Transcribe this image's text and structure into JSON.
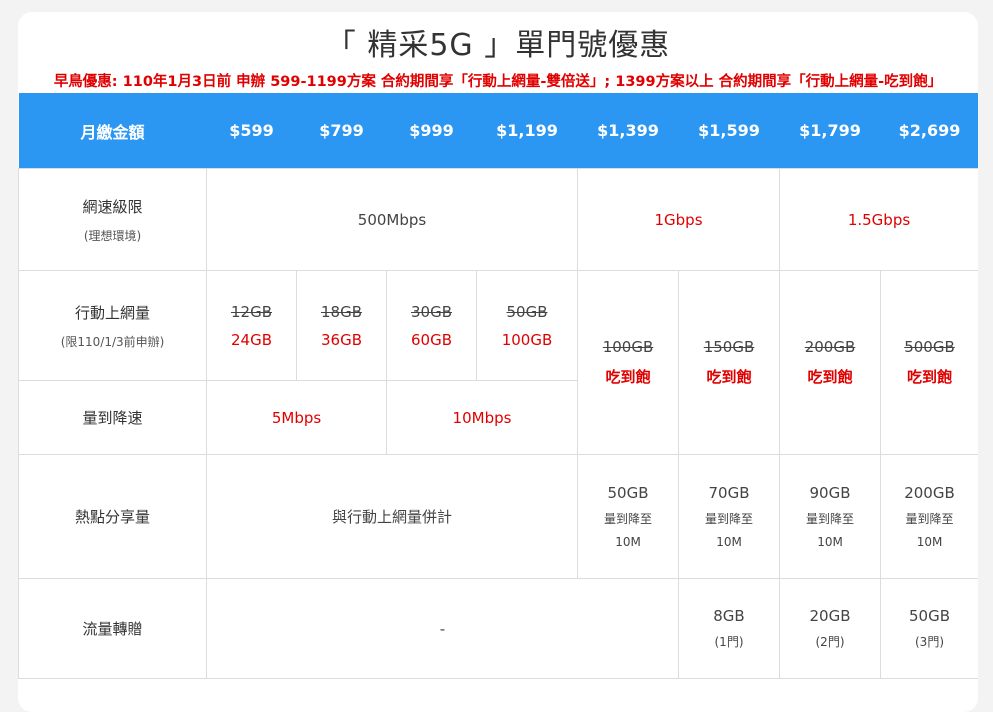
{
  "title": "「 精采5G 」單門號優惠",
  "promo": "早鳥優惠: 110年1月3日前 申辦 599-1199方案 合約期間享「行動上網量-雙倍送」; 1399方案以上 合約期間享「行動上網量-吃到飽」",
  "header": {
    "label": "月繳金額",
    "prices": [
      "$599",
      "$799",
      "$999",
      "$1,199",
      "$1,399",
      "$1,599",
      "$1,799",
      "$2,699"
    ]
  },
  "speed": {
    "label": "網速級限",
    "sub": "(理想環境)",
    "v1": "500Mbps",
    "v2": "1Gbps",
    "v3": "1.5Gbps"
  },
  "data": {
    "label": "行動上網量",
    "sub": "(限110/1/3前申辦)",
    "old": [
      "12GB",
      "18GB",
      "30GB",
      "50GB",
      "100GB",
      "150GB",
      "200GB",
      "500GB"
    ],
    "new": [
      "24GB",
      "36GB",
      "60GB",
      "100GB"
    ],
    "unlimited": "吃到飽"
  },
  "throttle": {
    "label": "量到降速",
    "v1": "5Mbps",
    "v2": "10Mbps"
  },
  "hotspot": {
    "label": "熱點分享量",
    "shared": "與行動上網量併計",
    "amounts": [
      "50GB",
      "70GB",
      "90GB",
      "200GB"
    ],
    "line2": "量到降至",
    "line3": "10M"
  },
  "gift": {
    "label": "流量轉贈",
    "none": "-",
    "amounts": [
      "8GB",
      "20GB",
      "50GB"
    ],
    "lines": [
      "(1門)",
      "(2門)",
      "(3門)"
    ]
  },
  "colors": {
    "accent": "#2c97f3",
    "highlight": "#e00000"
  }
}
